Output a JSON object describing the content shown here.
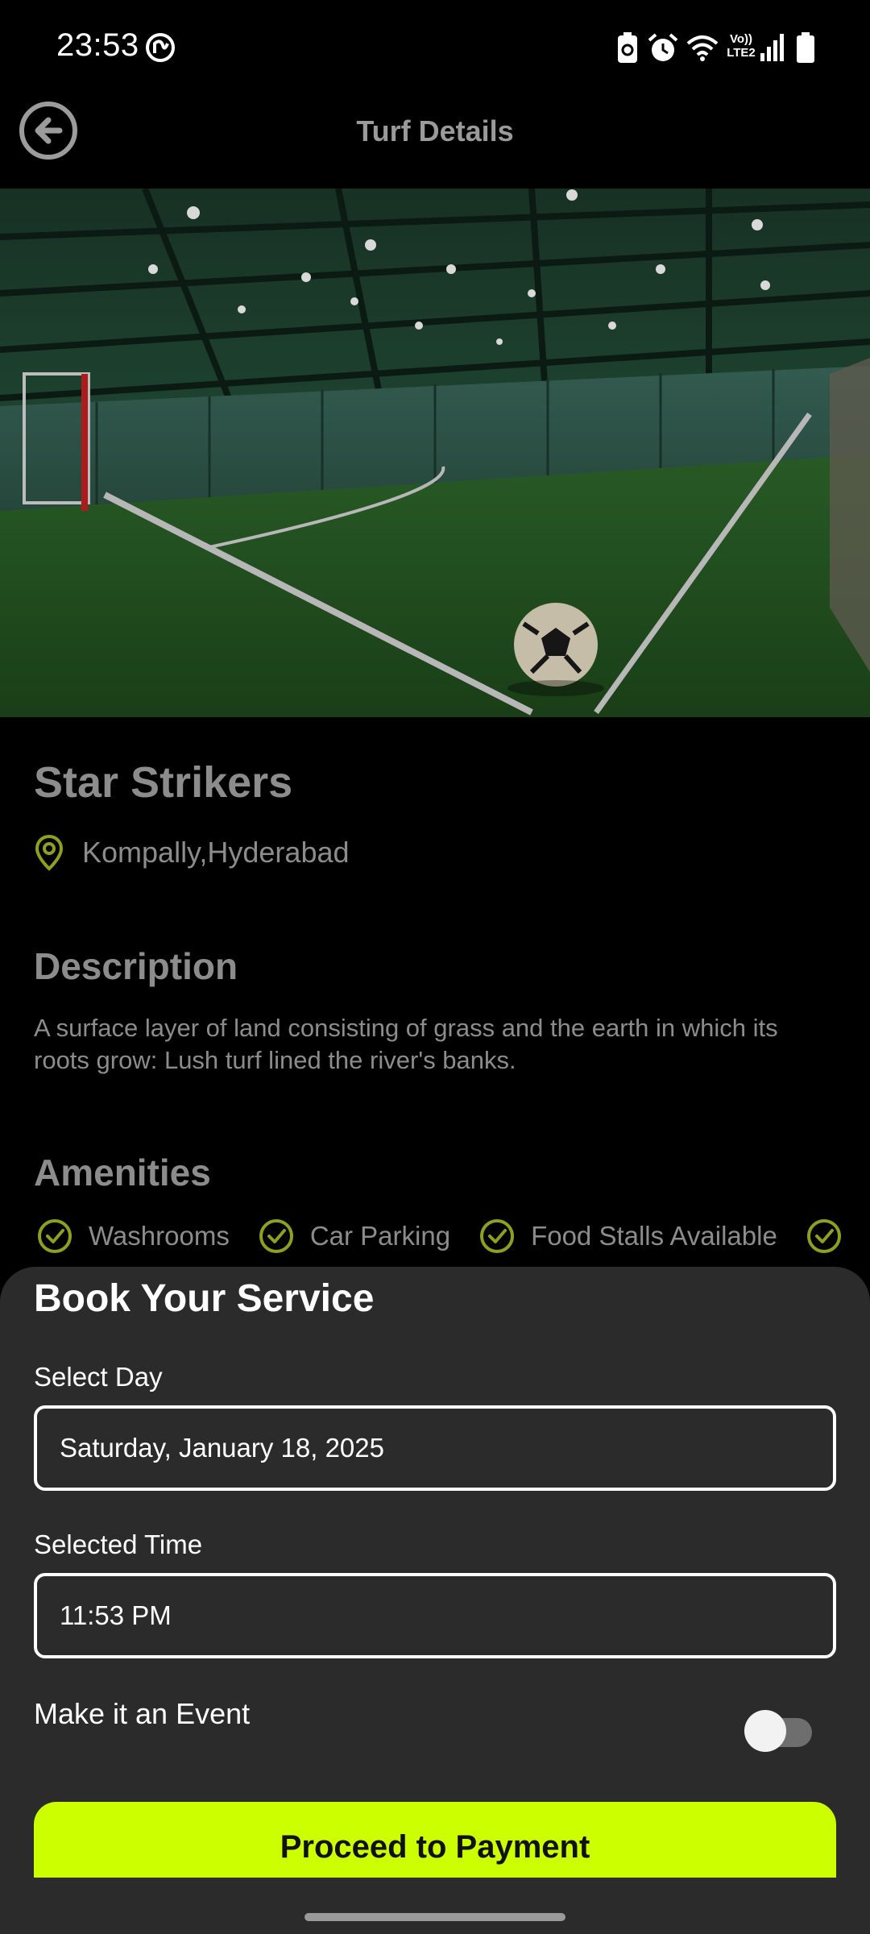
{
  "status_bar": {
    "time": "23:53",
    "icons": [
      "app-notification-icon",
      "battery-saver-icon",
      "alarm-icon",
      "wifi-icon",
      "volte-lte2-icon",
      "signal-icon",
      "battery-icon"
    ],
    "network_label_top": "Vo))",
    "network_label_bottom": "LTE2"
  },
  "app_bar": {
    "title": "Turf Details",
    "back_icon": "back-arrow-icon"
  },
  "turf": {
    "name": "Star Strikers",
    "location": "Kompally,Hyderabad",
    "location_icon": "location-pin-icon"
  },
  "description": {
    "heading": "Description",
    "body": "A surface layer of land consisting of grass and the earth in which its roots grow: Lush turf lined the river's banks."
  },
  "amenities": {
    "heading": "Amenities",
    "items": [
      {
        "label": "Washrooms",
        "icon": "check-circle-icon"
      },
      {
        "label": "Car Parking",
        "icon": "check-circle-icon"
      },
      {
        "label": "Food Stalls Available",
        "icon": "check-circle-icon"
      }
    ]
  },
  "booking": {
    "title": "Book Your Service",
    "day_label": "Select Day",
    "day_value": "Saturday, January 18, 2025",
    "time_label": "Selected Time",
    "time_value": "11:53 PM",
    "event_label": "Make it an Event",
    "event_enabled": false,
    "proceed_label": "Proceed to Payment"
  },
  "colors": {
    "accent": "#ccff00",
    "icon_green": "#8fa020",
    "sheet_bg": "#2b2b2b",
    "muted_text": "#8c8c8c"
  }
}
